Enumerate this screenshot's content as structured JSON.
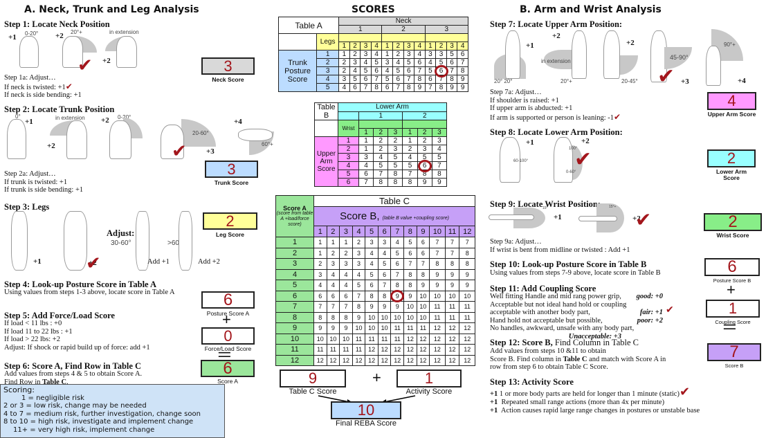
{
  "left": {
    "title": "A. Neck, Trunk and Leg Analysis",
    "step1": {
      "heading": "Step 1: Locate Neck Position",
      "figs": [
        {
          "score": "+1",
          "angle": "0-20°"
        },
        {
          "score": "+2",
          "angle": "20°+"
        },
        {
          "score": "+2",
          "angle": "in extension"
        }
      ],
      "adjust": [
        "Step 1a: Adjust…",
        "If neck is twisted: +1",
        "If neck is side bending: +1"
      ],
      "score": "3",
      "score_label": "Neck Score"
    },
    "step2": {
      "heading": "Step 2: Locate Trunk Position",
      "figs": [
        {
          "score": "+1",
          "angle": "0°"
        },
        {
          "score": "+2",
          "angle": "in extension"
        },
        {
          "score": "+2",
          "angle": "0-20°"
        },
        {
          "score": "+3",
          "angle": "20-60°"
        },
        {
          "score": "+4",
          "angle": "60°+"
        }
      ],
      "adjust": [
        "Step 2a: Adjust…",
        "If trunk is twisted: +1",
        "If trunk is side bending: +1"
      ],
      "score": "3",
      "score_label": "Trunk Score"
    },
    "step3": {
      "heading": "Step 3: Legs",
      "figs": [
        {
          "score": "+1"
        },
        {
          "score": "+2"
        }
      ],
      "adjust_label": "Adjust:",
      "adj": [
        {
          "angle": "30-60°",
          "add": "Add +1"
        },
        {
          "angle": ">60",
          "add": "Add +2"
        }
      ],
      "score": "2",
      "score_label": "Leg Score"
    },
    "step4": {
      "heading": "Step 4: Look-up Posture Score in Table A",
      "text": "Using values from steps 1-3 above, locate score in Table A",
      "score": "6",
      "score_label": "Posture Score A"
    },
    "step5": {
      "heading": "Step 5: Add Force/Load Score",
      "lines": [
        "If load < 11 lbs : +0",
        "If load 11 to 22 lbs : +1",
        "If load > 22 lbs: +2",
        "Adjust: If shock or rapid build up of force: add +1"
      ],
      "score": "0",
      "score_label": "Force/Load Score"
    },
    "step6": {
      "heading": "Step 6: Score A, Find Row in Table C",
      "line1": "Add values from steps 4 & 5 to obtain Score A.",
      "line2_pre": "Find Row in ",
      "line2_bold": "Table C",
      "line2_post": ".",
      "score": "6",
      "score_label": "Score A"
    },
    "plus": "+",
    "equals": "="
  },
  "scoring": {
    "title": "Scoring:",
    "lines": [
      "1 = negligible risk",
      "2 or 3 = low risk, change may be needed",
      "4 to 7 = medium risk, further investigation, change soon",
      "8 to 10 = high risk, investigate and implement change",
      "11+ = very high risk, implement change"
    ]
  },
  "center": {
    "title": "SCORES",
    "tableA": {
      "name": "Table A",
      "neck_label": "Neck",
      "legs_label": "Legs",
      "row_label": "Trunk Posture Score",
      "groups": [
        "1",
        "2",
        "3"
      ],
      "cols": [
        "1",
        "2",
        "3",
        "4"
      ],
      "rows": [
        [
          "1",
          "2",
          "3",
          "4",
          "1",
          "2",
          "3",
          "4",
          "3",
          "3",
          "5",
          "6"
        ],
        [
          "2",
          "3",
          "4",
          "5",
          "3",
          "4",
          "5",
          "6",
          "4",
          "5",
          "6",
          "7"
        ],
        [
          "2",
          "4",
          "5",
          "6",
          "4",
          "5",
          "6",
          "7",
          "5",
          "6",
          "7",
          "8"
        ],
        [
          "3",
          "5",
          "6",
          "7",
          "5",
          "6",
          "7",
          "8",
          "6",
          "7",
          "8",
          "9"
        ],
        [
          "4",
          "6",
          "7",
          "8",
          "6",
          "7",
          "8",
          "9",
          "7",
          "8",
          "9",
          "9"
        ]
      ],
      "highlight": {
        "row": 2,
        "col": 9
      }
    },
    "tableB": {
      "name": "Table B",
      "lower_label": "Lower Arm",
      "wrist_label": "Wrist",
      "row_label": "Upper Arm Score",
      "groups": [
        "1",
        "2"
      ],
      "cols": [
        "1",
        "2",
        "3"
      ],
      "rows": [
        [
          "1",
          "2",
          "2",
          "1",
          "2",
          "3"
        ],
        [
          "1",
          "2",
          "3",
          "2",
          "3",
          "4"
        ],
        [
          "3",
          "4",
          "5",
          "4",
          "5",
          "5"
        ],
        [
          "4",
          "5",
          "5",
          "5",
          "6",
          "7"
        ],
        [
          "6",
          "7",
          "8",
          "7",
          "8",
          "8"
        ],
        [
          "7",
          "8",
          "8",
          "8",
          "9",
          "9"
        ]
      ],
      "highlight": {
        "row": 3,
        "col": 4
      }
    },
    "tableC": {
      "name": "Table C",
      "scoreA_label": "Score A",
      "scoreA_note": "(score from table A +load/force score)",
      "scoreB_label": "Score B,",
      "scoreB_note": "(table B value +coupling score)",
      "cols": [
        "1",
        "2",
        "3",
        "4",
        "5",
        "6",
        "7",
        "8",
        "9",
        "10",
        "11",
        "12"
      ],
      "rows": [
        [
          "1",
          "1",
          "1",
          "2",
          "3",
          "3",
          "4",
          "5",
          "6",
          "7",
          "7",
          "7"
        ],
        [
          "1",
          "2",
          "2",
          "3",
          "4",
          "4",
          "5",
          "6",
          "6",
          "7",
          "7",
          "8"
        ],
        [
          "2",
          "3",
          "3",
          "3",
          "4",
          "5",
          "6",
          "7",
          "7",
          "8",
          "8",
          "8"
        ],
        [
          "3",
          "4",
          "4",
          "4",
          "5",
          "6",
          "7",
          "8",
          "8",
          "9",
          "9",
          "9"
        ],
        [
          "4",
          "4",
          "4",
          "5",
          "6",
          "7",
          "8",
          "8",
          "9",
          "9",
          "9",
          "9"
        ],
        [
          "6",
          "6",
          "6",
          "7",
          "8",
          "8",
          "9",
          "9",
          "10",
          "10",
          "10",
          "10"
        ],
        [
          "7",
          "7",
          "7",
          "8",
          "9",
          "9",
          "9",
          "10",
          "10",
          "11",
          "11",
          "11"
        ],
        [
          "8",
          "8",
          "8",
          "9",
          "10",
          "10",
          "10",
          "10",
          "10",
          "11",
          "11",
          "11"
        ],
        [
          "9",
          "9",
          "9",
          "10",
          "10",
          "10",
          "11",
          "11",
          "11",
          "12",
          "12",
          "12"
        ],
        [
          "10",
          "10",
          "10",
          "11",
          "11",
          "11",
          "11",
          "12",
          "12",
          "12",
          "12",
          "12"
        ],
        [
          "11",
          "11",
          "11",
          "11",
          "12",
          "12",
          "12",
          "12",
          "12",
          "12",
          "12",
          "12"
        ],
        [
          "12",
          "12",
          "12",
          "12",
          "12",
          "12",
          "12",
          "12",
          "12",
          "12",
          "12",
          "12"
        ]
      ],
      "highlight": {
        "row": 5,
        "col": 6
      }
    },
    "tableC_score": "9",
    "tableC_score_label": "Table C Score",
    "plus": "+",
    "activity_score": "1",
    "activity_label": "Activity Score",
    "final_score": "10",
    "final_label": "Final REBA Score"
  },
  "right": {
    "title": "B. Arm and Wrist Analysis",
    "step7": {
      "heading": "Step 7: Locate Upper Arm Position:",
      "figs": [
        {
          "score": "+1",
          "angle": "20°   20°"
        },
        {
          "score": "+2",
          "angle": "in extension",
          "angle2": "20°+"
        },
        {
          "score": "+2",
          "angle": "20-45°"
        },
        {
          "score": "+3",
          "angle": "45-90°"
        },
        {
          "score": "+4",
          "angle": "90°+"
        }
      ],
      "adjust": [
        "Step 7a: Adjust…",
        "If shoulder is raised: +1",
        "If upper arm is abducted: +1",
        "If arm is supported or person is leaning: -1"
      ],
      "score": "4",
      "score_label": "Upper Arm Score"
    },
    "step8": {
      "heading": "Step 8: Locate Lower Arm Position:",
      "figs": [
        {
          "score": "+1",
          "angle": "60-100°"
        },
        {
          "score": "+2",
          "angle": "100°",
          "angle2": "0-60°"
        }
      ],
      "score": "2",
      "score_label": "Lower Arm Score"
    },
    "step9": {
      "heading": "Step 9: Locate Wrist Position:",
      "figs": [
        {
          "score": "+1",
          "angle": "15°"
        },
        {
          "score": "+2",
          "angle": "15°+"
        }
      ],
      "adjust": [
        "Step 9a: Adjust…",
        "If wrist is bent from midline or twisted : Add +1"
      ],
      "score": "2",
      "score_label": "Wrist Score"
    },
    "step10": {
      "heading": "Step 10: Look-up Posture Score in Table B",
      "text": "Using values from steps 7-9 above, locate score in Table B",
      "score": "6",
      "score_label": "Posture Score B"
    },
    "step11": {
      "heading": "Step 11: Add Coupling Score",
      "lines": [
        {
          "t": "Well fitting Handle and mid rang power grip,",
          "k": "good: +0"
        },
        {
          "t": "Acceptable but not ideal hand hold or coupling",
          "k": ""
        },
        {
          "t": "acceptable with another body part,",
          "k": "fair: +1"
        },
        {
          "t": "Hand hold not acceptable but possible,",
          "k": "poor: +2"
        },
        {
          "t": "No handles, awkward, unsafe with any body part,",
          "k": ""
        },
        {
          "t": "",
          "k": "Unacceptable: +3"
        }
      ],
      "score": "1",
      "score_label": "Coupling Score"
    },
    "step12": {
      "heading_bold": "Step 12: Score B,",
      "heading_rest": " Find Column in Table C",
      "line1": "Add values from steps 10 &11 to obtain",
      "line2_pre": "Score B. Find column in ",
      "line2_bold": "Table C",
      "line2_post": " and match with Score A in",
      "line3": "row from step 6 to obtain Table C Score.",
      "score": "7",
      "score_label": "Score B"
    },
    "step13": {
      "heading": "Step 13: Activity Score",
      "lines": [
        {
          "p": "+1",
          "t": "1 or more body parts are held for longer than 1 minute (static)"
        },
        {
          "p": "+1",
          "t": "Repeated small range actions (more than 4x per minute)"
        },
        {
          "p": "+1",
          "t": "Action causes rapid large range changes in postures or unstable base"
        }
      ]
    },
    "plus": "+",
    "equals": "="
  },
  "colors": {
    "score_text": "#a3161c",
    "neck": "#d9d9d9",
    "trunk": "#bcdcff",
    "leg": "#ffff99",
    "scoreA": "#9be69b",
    "upper_arm": "#ff99ff",
    "lower_arm": "#99ffff",
    "wrist": "#88ee88",
    "scoreB": "#c6a0f7",
    "scoring_bg": "#cfe3f7"
  }
}
